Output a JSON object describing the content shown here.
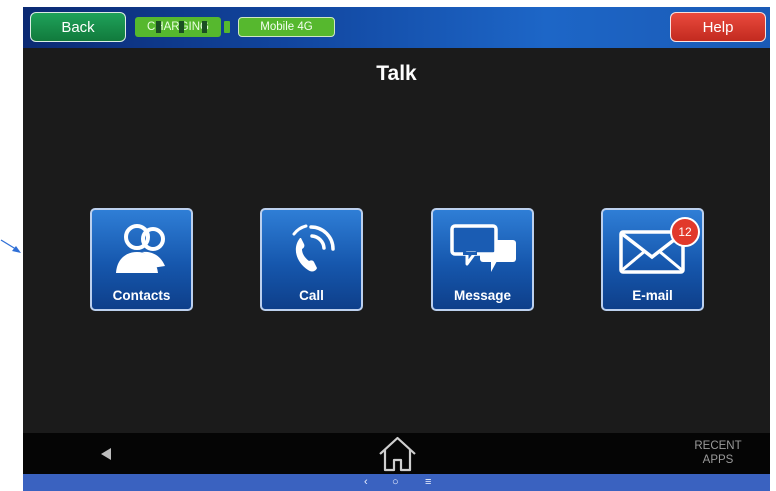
{
  "header": {
    "back_label": "Back",
    "charging_label": "CHARGING",
    "network_label": "Mobile 4G",
    "help_label": "Help"
  },
  "page": {
    "title": "Talk"
  },
  "tiles": [
    {
      "label": "Contacts",
      "icon": "contacts-icon"
    },
    {
      "label": "Call",
      "icon": "phone-icon"
    },
    {
      "label": "Message",
      "icon": "message-icon"
    },
    {
      "label": "E-mail",
      "icon": "mail-icon",
      "badge": "12"
    }
  ],
  "navbar": {
    "recent_line1": "RECENT",
    "recent_line2": "APPS",
    "icons": [
      "back-triangle-icon",
      "home-icon"
    ]
  },
  "system_bar": {
    "back": "‹",
    "home": "○",
    "menu": "≡"
  },
  "colors": {
    "back_button": "#1a9050",
    "help_button": "#d9362a",
    "status_green": "#56b82e",
    "tile_blue": "#1f63bb",
    "badge_red": "#e1392b",
    "background": "#1b1b1b"
  }
}
